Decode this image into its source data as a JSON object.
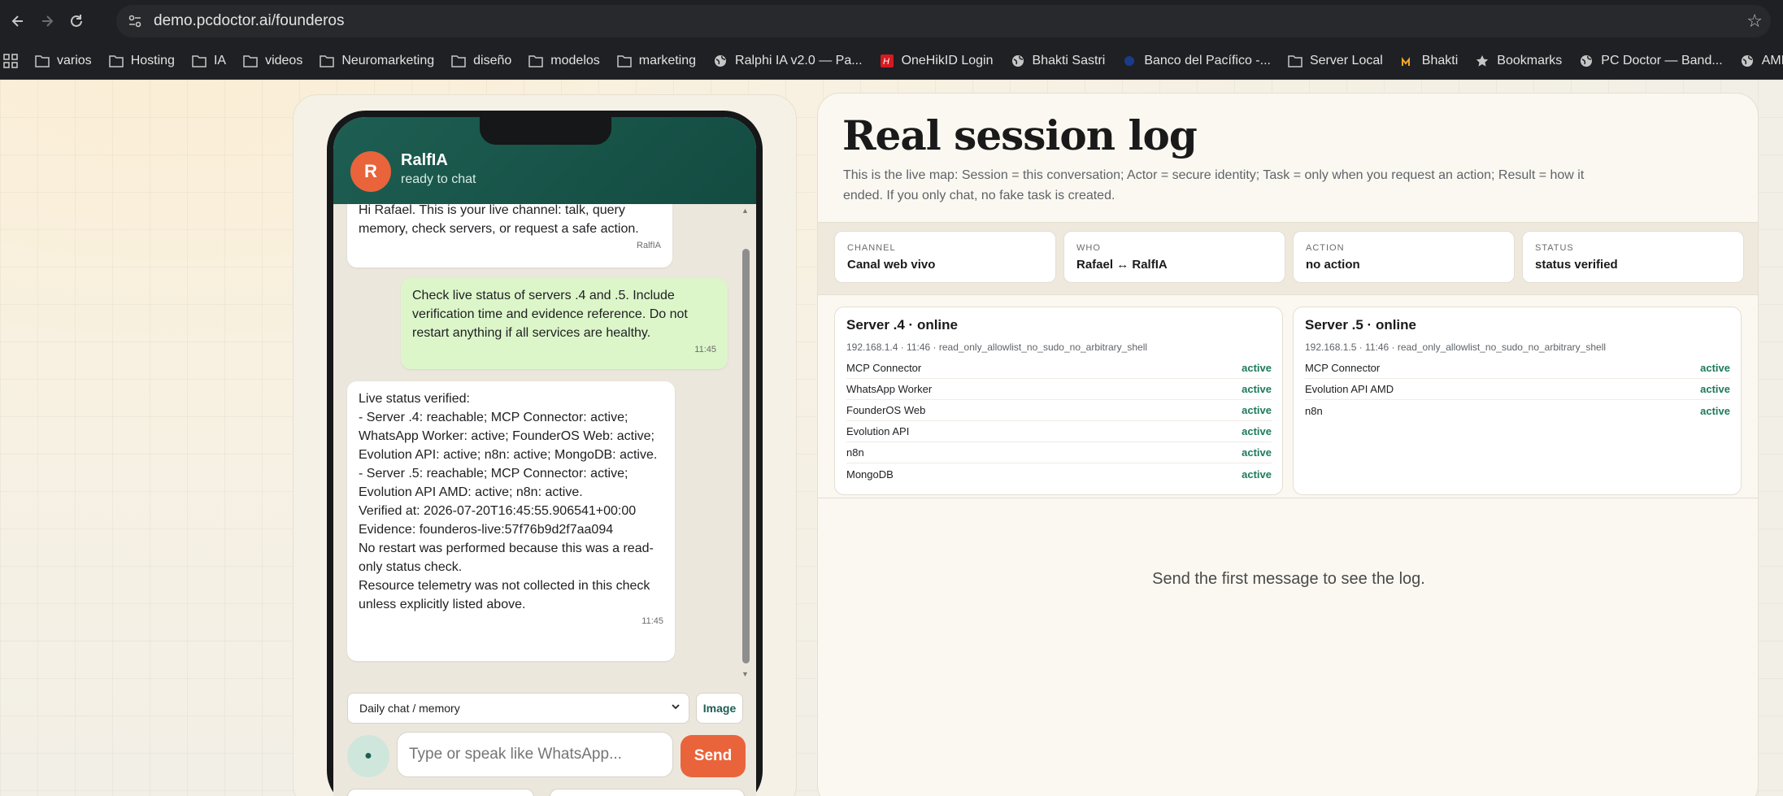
{
  "browser": {
    "url": "demo.pcdoctor.ai/founderos",
    "bookmarks": [
      {
        "label": "varios",
        "icon": "folder-icon"
      },
      {
        "label": "Hosting",
        "icon": "folder-icon"
      },
      {
        "label": "IA",
        "icon": "folder-icon"
      },
      {
        "label": "videos",
        "icon": "folder-icon"
      },
      {
        "label": "Neuromarketing",
        "icon": "folder-icon"
      },
      {
        "label": "diseño",
        "icon": "folder-icon"
      },
      {
        "label": "modelos",
        "icon": "folder-icon"
      },
      {
        "label": "marketing",
        "icon": "folder-icon"
      },
      {
        "label": "Ralphi IA v2.0 — Pa...",
        "icon": "globe-icon"
      },
      {
        "label": "OneHikID Login",
        "icon": "hikvision-icon"
      },
      {
        "label": "Bhakti Sastri",
        "icon": "globe-icon"
      },
      {
        "label": "Banco del Pacífico -...",
        "icon": "bank-icon"
      },
      {
        "label": "Server Local",
        "icon": "folder-icon"
      },
      {
        "label": "Bhakti",
        "icon": "m-logo-icon"
      },
      {
        "label": "Bookmarks",
        "icon": "star-icon"
      },
      {
        "label": "PC Doctor — Band...",
        "icon": "globe-icon"
      },
      {
        "label": "AMD Ju",
        "icon": "globe-icon"
      }
    ]
  },
  "chat": {
    "avatar_letter": "R",
    "contact_name": "RalfIA",
    "contact_status": "ready to chat",
    "messages": [
      {
        "direction": "in",
        "text": "Hi Rafael. This is your live channel: talk, query memory, check servers, or request a safe action.",
        "time": "RalfIA"
      },
      {
        "direction": "out",
        "text": "Check live status of servers .4 and .5. Include verification time and evidence reference. Do not restart anything if all services are healthy.",
        "time": "11:45"
      },
      {
        "direction": "in",
        "text": "Live status verified:\n- Server .4: reachable; MCP Connector: active; WhatsApp Worker: active; FounderOS Web: active; Evolution API: active; n8n: active; MongoDB: active.\n- Server .5: reachable; MCP Connector: active; Evolution API AMD: active; n8n: active.\nVerified at: 2026-07-20T16:45:55.906541+00:00\nEvidence: founderos-live:57f76b9d2f7aa094\nNo restart was performed because this was a read-only status check.\nResource telemetry was not collected in this check unless explicitly listed above.",
        "time": "11:45"
      }
    ],
    "mode_select": "Daily chat / memory",
    "image_button": "Image",
    "input_placeholder": "Type or speak like WhatsApp...",
    "send_button": "Send"
  },
  "log": {
    "title": "Real session log",
    "subtitle": "This is the live map: Session = this conversation; Actor = secure identity; Task = only when you request an action; Result = how it ended. If you only chat, no fake task is created.",
    "cards": [
      {
        "label": "CHANNEL",
        "value": "Canal web vivo"
      },
      {
        "label": "WHO",
        "value": "Rafael ↔ RalfIA"
      },
      {
        "label": "ACTION",
        "value": "no action"
      },
      {
        "label": "STATUS",
        "value": "status verified"
      }
    ],
    "servers": [
      {
        "title": "Server .4 · online",
        "meta": "192.168.1.4 · 11:46 · read_only_allowlist_no_sudo_no_arbitrary_shell",
        "services": [
          {
            "name": "MCP Connector",
            "status": "active"
          },
          {
            "name": "WhatsApp Worker",
            "status": "active"
          },
          {
            "name": "FounderOS Web",
            "status": "active"
          },
          {
            "name": "Evolution API",
            "status": "active"
          },
          {
            "name": "n8n",
            "status": "active"
          },
          {
            "name": "MongoDB",
            "status": "active"
          }
        ]
      },
      {
        "title": "Server .5 · online",
        "meta": "192.168.1.5 · 11:46 · read_only_allowlist_no_sudo_no_arbitrary_shell",
        "services": [
          {
            "name": "MCP Connector",
            "status": "active"
          },
          {
            "name": "Evolution API AMD",
            "status": "active"
          },
          {
            "name": "n8n",
            "status": "active"
          }
        ]
      }
    ],
    "empty_message": "Send the first message to see the log."
  },
  "colors": {
    "brand_green": "#1e5e52",
    "accent_orange": "#e9643b",
    "active_green": "#1e7a5c",
    "outgoing_bubble": "#dcf6c9"
  }
}
